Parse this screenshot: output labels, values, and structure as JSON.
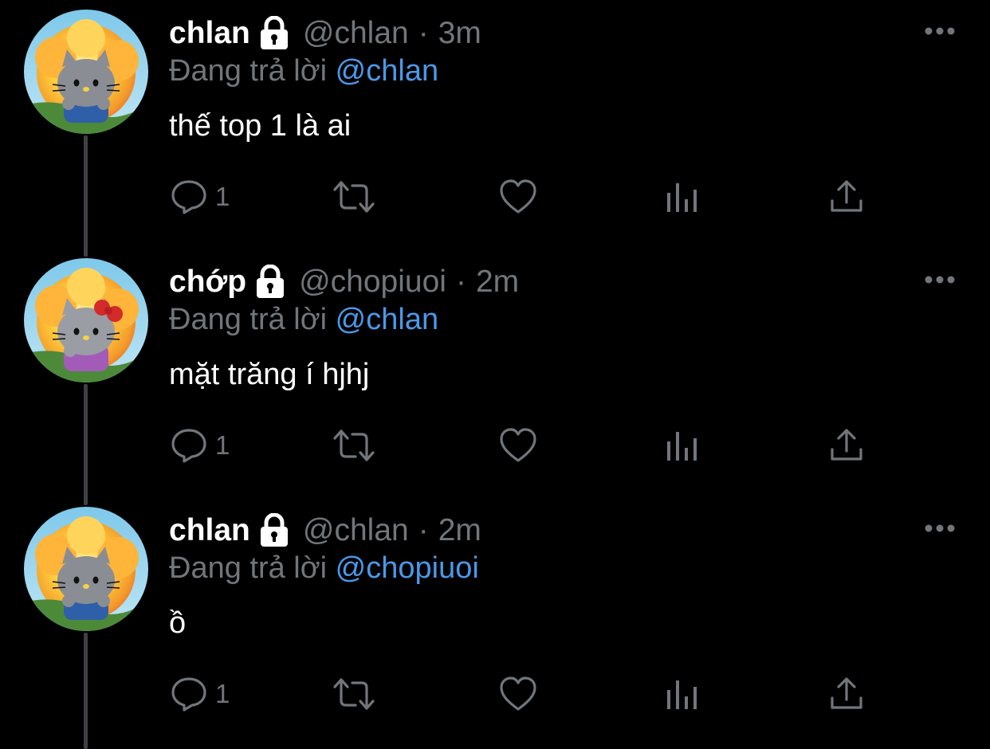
{
  "colors": {
    "background": "#000000",
    "text": "#ffffff",
    "muted": "#71767b",
    "mention": "#4a99e9",
    "thread_line": "#3e4144"
  },
  "tweets": [
    {
      "name": "chlan",
      "handle": "@chlan",
      "separator": "·",
      "time": "3m",
      "reply_prefix": "Đang trả lời",
      "reply_to": "@chlan",
      "text": "thế top 1 là ai",
      "reply_count": "1",
      "avatar": "hello-kitty-avatar-blue-shirt",
      "locked": true
    },
    {
      "name": "chớp",
      "handle": "@chopiuoi",
      "separator": "·",
      "time": "2m",
      "reply_prefix": "Đang trả lời",
      "reply_to": "@chlan",
      "text": "mặt trăng í hjhj",
      "reply_count": "1",
      "avatar": "hello-kitty-avatar-red-bow",
      "locked": true
    },
    {
      "name": "chlan",
      "handle": "@chlan",
      "separator": "·",
      "time": "2m",
      "reply_prefix": "Đang trả lời",
      "reply_to": "@chopiuoi",
      "text": "ồ",
      "reply_count": "1",
      "avatar": "hello-kitty-avatar-blue-shirt",
      "locked": true
    }
  ],
  "icons": {
    "lock": "lock-icon",
    "more": "more-icon",
    "reply": "reply-icon",
    "retweet": "retweet-icon",
    "like": "heart-icon",
    "analytics": "analytics-icon",
    "share": "share-icon"
  }
}
